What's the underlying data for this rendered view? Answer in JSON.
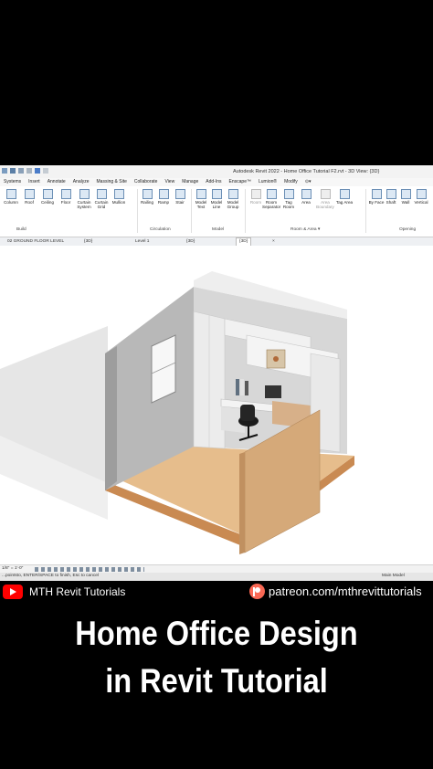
{
  "window": {
    "title": "Autodesk Revit 2022 - Home Office Tutorial F2.rvt - 3D View: {3D}"
  },
  "ribbon": {
    "tabs": [
      "Systems",
      "Insert",
      "Annotate",
      "Analyze",
      "Massing & Site",
      "Collaborate",
      "View",
      "Manage",
      "Add-Ins",
      "Enscape™",
      "Lumion®",
      "Modify",
      "⊙▾"
    ],
    "tools": [
      {
        "label": "Column",
        "icon": "column-icon"
      },
      {
        "label": "Roof",
        "icon": "roof-icon"
      },
      {
        "label": "Ceiling",
        "icon": "ceiling-icon"
      },
      {
        "label": "Floor",
        "icon": "floor-icon"
      },
      {
        "label": "Curtain System",
        "icon": "curtain-system-icon"
      },
      {
        "label": "Curtain Grid",
        "icon": "curtain-grid-icon"
      },
      {
        "label": "Mullion",
        "icon": "mullion-icon"
      },
      {
        "label": "Railing",
        "icon": "railing-icon"
      },
      {
        "label": "Ramp",
        "icon": "ramp-icon"
      },
      {
        "label": "Stair",
        "icon": "stair-icon"
      },
      {
        "label": "Model Text",
        "icon": "model-text-icon"
      },
      {
        "label": "Model Line",
        "icon": "model-line-icon"
      },
      {
        "label": "Model Group",
        "icon": "model-group-icon"
      },
      {
        "label": "Room",
        "icon": "room-icon",
        "dim": true
      },
      {
        "label": "Room Separator",
        "icon": "room-separator-icon"
      },
      {
        "label": "Tag Room",
        "icon": "tag-room-icon"
      },
      {
        "label": "Area",
        "icon": "area-icon"
      },
      {
        "label": "Area Boundary",
        "icon": "area-boundary-icon",
        "dim": true
      },
      {
        "label": "Tag Area",
        "icon": "tag-area-icon"
      },
      {
        "label": "By Face",
        "icon": "by-face-icon"
      },
      {
        "label": "Shaft",
        "icon": "shaft-icon"
      },
      {
        "label": "Wall",
        "icon": "wall-opening-icon"
      },
      {
        "label": "Vertical",
        "icon": "vertical-opening-icon"
      }
    ],
    "panels": {
      "build": "Build",
      "circulation": "Circulation",
      "model": "Model",
      "room_area": "Room & Area ▾",
      "opening": "Opening"
    }
  },
  "view_tabs": {
    "floor_plan": "02 GROUND FLOOR LEVEL",
    "tab2": "{3D}",
    "tab3": "Level 1",
    "tab4": "{3D}",
    "active": "{3D}",
    "close": "×"
  },
  "status": {
    "scale": "1/8\" = 1'-0\"",
    "prompt": "...pointsto, ENTER/SPACE to finish, Esc to cancel",
    "model": "Main Model"
  },
  "branding": {
    "channel": "MTH Revit Tutorials",
    "patreon": "patreon.com/mthrevittutorials"
  },
  "headline": {
    "line1": "Home Office Design",
    "line2": "in Revit Tutorial"
  }
}
